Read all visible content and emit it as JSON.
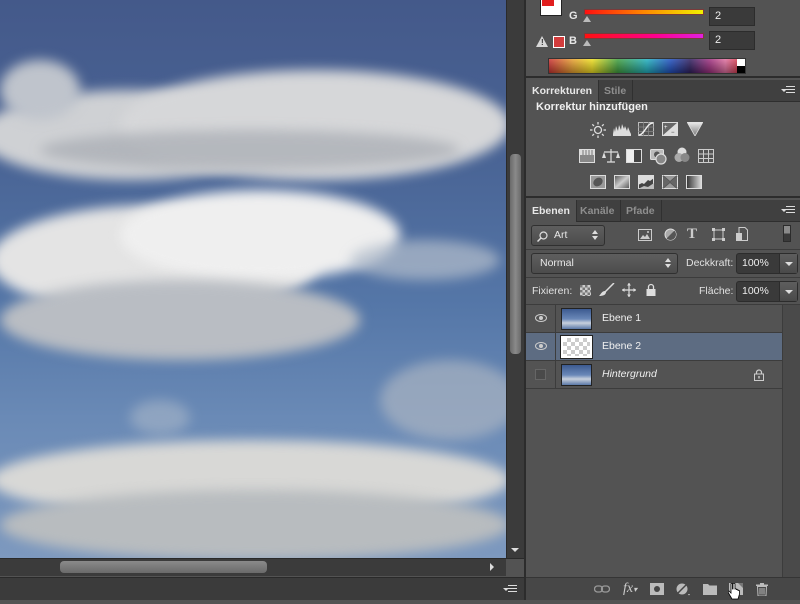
{
  "colors": {
    "foreground": "#e11e1e",
    "background": "#ffffff",
    "selected_layer_bg": "#5d6c82",
    "panel_bg": "#535353"
  },
  "color_panel": {
    "channels": [
      {
        "label": "G",
        "value": "2"
      },
      {
        "label": "B",
        "value": "2"
      }
    ],
    "gamut_warning_icon": "warning-triangle-icon"
  },
  "adjustments_panel": {
    "tabs": [
      {
        "label": "Korrekturen",
        "active": true
      },
      {
        "label": "Stile",
        "active": false
      }
    ],
    "heading": "Korrektur hinzufügen",
    "icon_rows": [
      [
        "brightness-contrast-icon",
        "levels-icon",
        "curves-icon",
        "exposure-icon",
        "gradient-triangle-icon"
      ],
      [
        "hue-saturation-icon",
        "color-balance-icon",
        "black-white-icon",
        "photo-filter-icon",
        "channel-mixer-icon",
        "color-lookup-icon"
      ],
      [
        "invert-icon",
        "posterize-icon",
        "threshold-icon",
        "selective-color-icon",
        "gradient-map-icon"
      ]
    ]
  },
  "layers_panel": {
    "tabs": [
      {
        "label": "Ebenen",
        "active": true
      },
      {
        "label": "Kanäle",
        "active": false
      },
      {
        "label": "Pfade",
        "active": false
      }
    ],
    "filter_kind": "Art",
    "blend_mode": "Normal",
    "opacity_label": "Deckkraft:",
    "opacity_value": "100%",
    "lock_label": "Fixieren:",
    "fill_label": "Fläche:",
    "fill_value": "100%",
    "layers": [
      {
        "name": "Ebene 1",
        "visible": true,
        "selected": false,
        "italic": false,
        "locked": false,
        "thumb": "sky"
      },
      {
        "name": "Ebene 2",
        "visible": true,
        "selected": true,
        "italic": false,
        "locked": false,
        "thumb": "transparent"
      },
      {
        "name": "Hintergrund",
        "visible": false,
        "selected": false,
        "italic": true,
        "locked": true,
        "thumb": "sky"
      }
    ],
    "footer_icons": [
      "link-layers-icon",
      "fx-icon",
      "mask-icon",
      "adjustment-layer-icon",
      "group-folder-icon",
      "new-layer-icon",
      "trash-icon"
    ]
  }
}
